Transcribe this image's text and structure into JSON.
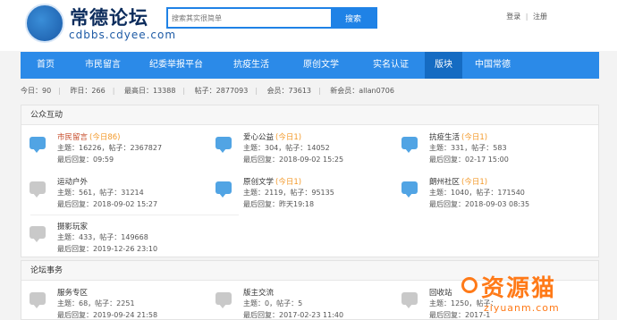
{
  "header": {
    "logo_icon": "city-emblem-icon",
    "logo_title": "常德论坛",
    "logo_url": "cdbbs.cdyee.com",
    "search_placeholder": "搜索其实很简单",
    "search_button": "搜索",
    "login": "登录",
    "separator": "|",
    "register": "注册"
  },
  "nav": {
    "items": [
      "首页",
      "市民留言",
      "纪委举报平台",
      "抗疫生活",
      "原创文学",
      "实名认证",
      "版块",
      "中国常德"
    ],
    "active_index": 6
  },
  "stats": {
    "today": "今日：90",
    "yesterday": "昨日：266",
    "max": "最高日：13388",
    "posts": "帖子：2877093",
    "members": "会员：73613",
    "newest": "新会员：allan0706"
  },
  "section1": {
    "title": "公众互动",
    "forums": [
      {
        "name": "市民留言",
        "today": "(今日86)",
        "stats": "主题：16226，帖子：2367827",
        "last": "最后回复：09:59",
        "icon": "chat-bubble-icon"
      },
      {
        "name": "爱心公益",
        "today": "(今日1)",
        "stats": "主题：304，帖子：14052",
        "last": "最后回复：2018-09-02 15:25",
        "icon": "chat-bubble-icon"
      },
      {
        "name": "抗疫生活",
        "today": "(今日1)",
        "stats": "主题：331，帖子：583",
        "last": "最后回复：02-17 15:00",
        "icon": "chat-bubble-icon"
      },
      {
        "name": "运动户外",
        "today": "",
        "stats": "主题：561，帖子：31214",
        "last": "最后回复：2018-09-02 15:27",
        "icon": "chat-bubble-icon"
      },
      {
        "name": "原创文学",
        "today": "(今日1)",
        "stats": "主题：2119，帖子：95135",
        "last": "最后回复：昨天19:18",
        "icon": "chat-bubble-icon"
      },
      {
        "name": "朗州社区",
        "today": "(今日1)",
        "stats": "主题：1040，帖子：171540",
        "last": "最后回复：2018-09-03 08:35",
        "icon": "chat-bubble-icon"
      },
      {
        "name": "摄影玩家",
        "today": "",
        "stats": "主题：433，帖子：149668",
        "last": "最后回复：2019-12-26 23:10",
        "icon": "chat-bubble-icon"
      }
    ]
  },
  "section2": {
    "title": "论坛事务",
    "forums": [
      {
        "name": "服务专区",
        "today": "",
        "stats": "主题：68，帖子：2251",
        "last": "最后回复：2019-09-24 21:58",
        "icon": "chat-bubble-icon"
      },
      {
        "name": "版主交流",
        "today": "",
        "stats": "主题：0，帖子：5",
        "last": "最后回复：2017-02-23 11:40",
        "icon": "chat-bubble-icon"
      },
      {
        "name": "回收站",
        "today": "",
        "stats": "主题：1250，帖子：",
        "last": "最后回复：2017-1",
        "icon": "chat-bubble-icon"
      }
    ]
  },
  "watermark": {
    "text": "资源猫",
    "url": "ziyuanm.com",
    "icon": "cat-logo-icon"
  }
}
